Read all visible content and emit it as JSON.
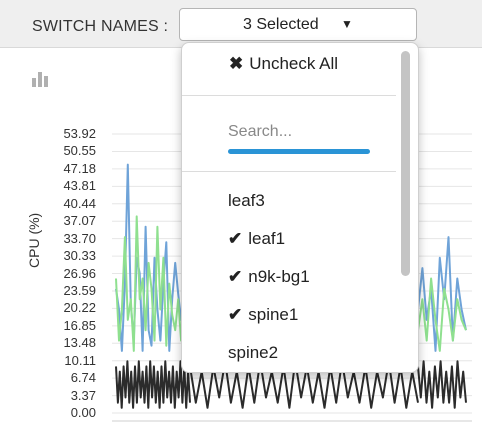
{
  "filter": {
    "label": "SWITCH NAMES :",
    "selected_text": "3 Selected",
    "caret_icon": "caret-down-icon"
  },
  "dropdown": {
    "uncheck_label": "Uncheck All",
    "search_placeholder": "Search...",
    "options": [
      {
        "label": "leaf3",
        "checked": false
      },
      {
        "label": "leaf1",
        "checked": true
      },
      {
        "label": "n9k-bg1",
        "checked": true
      },
      {
        "label": "spine1",
        "checked": true
      },
      {
        "label": "spine2",
        "checked": false
      }
    ]
  },
  "chart_data": {
    "type": "line",
    "ylabel": "CPU (%)",
    "yticks": [
      "53.92",
      "50.55",
      "47.18",
      "43.81",
      "40.44",
      "37.07",
      "33.70",
      "30.33",
      "26.96",
      "23.59",
      "20.22",
      "16.85",
      "13.48",
      "10.11",
      "6.74",
      "3.37",
      "0.00"
    ],
    "ylim": [
      0,
      53.92
    ],
    "grid": true,
    "series": [
      {
        "color": "#6fa3d8",
        "values": [
          24,
          20,
          12,
          25,
          48,
          21,
          14,
          30,
          27,
          12,
          36,
          16,
          13,
          30,
          20,
          14,
          25,
          33,
          12,
          22,
          29,
          23,
          18,
          20,
          22,
          15
        ]
      },
      {
        "color": "#8fe08f",
        "values": [
          26,
          14,
          20,
          34,
          18,
          22,
          12,
          38,
          22,
          26,
          16,
          29,
          24,
          14,
          36,
          20,
          30,
          13,
          25,
          19,
          16,
          22,
          14,
          18,
          18,
          20
        ]
      },
      {
        "color": "#2b2b2b",
        "values": [
          9,
          2,
          8,
          1,
          9,
          3,
          10,
          2,
          8,
          1,
          9,
          2,
          10,
          3,
          8,
          2,
          9,
          1,
          10,
          3,
          9,
          2,
          8,
          1,
          9,
          2,
          10,
          3,
          8,
          2,
          9,
          1,
          8,
          3,
          10,
          2,
          9,
          1,
          8,
          2
        ]
      }
    ],
    "right_values": {
      "blue": [
        20,
        28,
        18,
        24,
        12,
        30,
        22,
        34,
        14,
        26,
        20,
        16
      ],
      "green": [
        16,
        22,
        14,
        26,
        18,
        12,
        24,
        20,
        14,
        22,
        18,
        16
      ],
      "black": [
        9,
        3,
        10,
        2,
        8,
        1,
        9,
        3,
        10,
        2,
        8,
        2,
        9,
        1,
        10,
        3,
        8,
        2
      ]
    }
  }
}
